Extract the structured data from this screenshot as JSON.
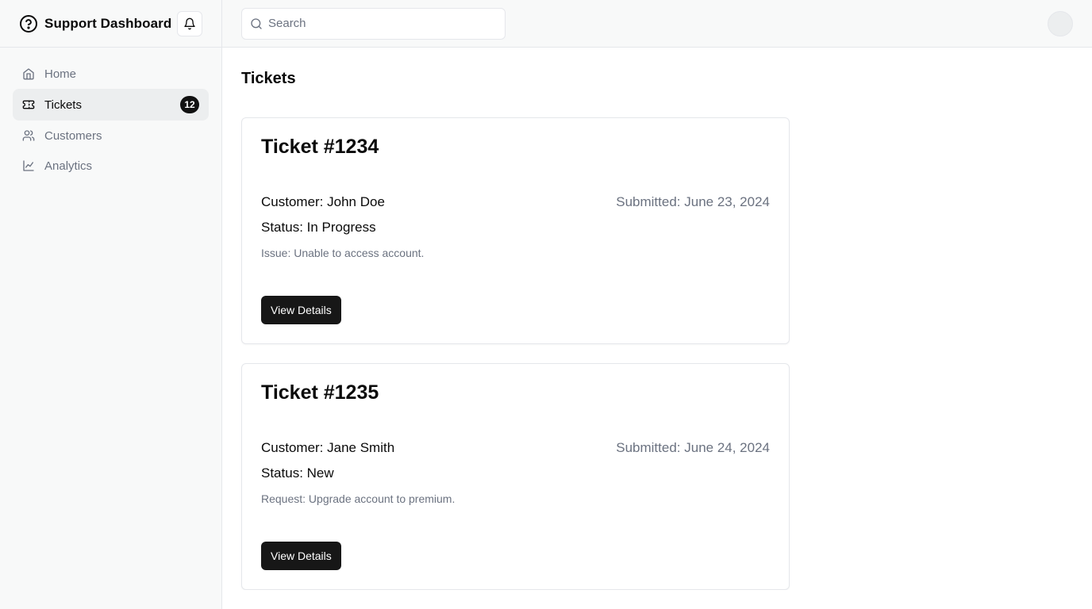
{
  "app": {
    "title": "Support Dashboard"
  },
  "search": {
    "placeholder": "Search",
    "value": ""
  },
  "sidebar": {
    "items": [
      {
        "label": "Home",
        "icon": "home-icon"
      },
      {
        "label": "Tickets",
        "icon": "ticket-icon",
        "badge": "12",
        "active": true
      },
      {
        "label": "Customers",
        "icon": "users-icon"
      },
      {
        "label": "Analytics",
        "icon": "line-chart-icon"
      }
    ]
  },
  "page": {
    "title": "Tickets"
  },
  "tickets": [
    {
      "title": "Ticket #1234",
      "customer": "Customer: John Doe",
      "submitted": "Submitted: June 23, 2024",
      "status": "Status: In Progress",
      "issue": "Issue: Unable to access account.",
      "button": "View Details"
    },
    {
      "title": "Ticket #1235",
      "customer": "Customer: Jane Smith",
      "submitted": "Submitted: June 24, 2024",
      "status": "Status: New",
      "issue": "Request: Upgrade account to premium.",
      "button": "View Details"
    }
  ],
  "colors": {
    "sidebar_bg": "#f8f9f9",
    "active_bg": "#eceeef",
    "primary_button": "#171717",
    "muted_text": "#6b7280",
    "border": "#e5e7eb"
  }
}
